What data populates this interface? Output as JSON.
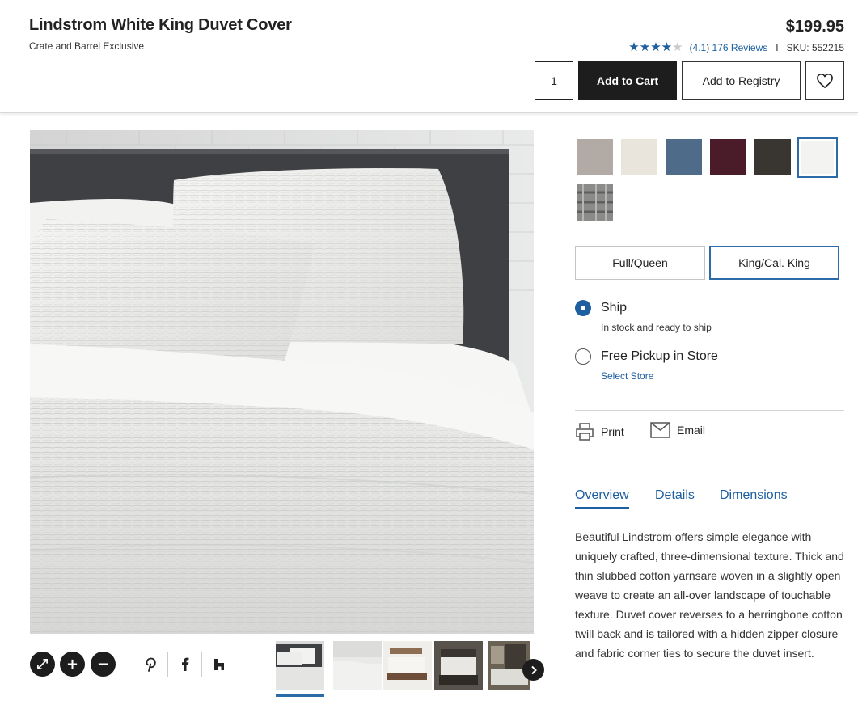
{
  "product": {
    "title": "Lindstrom White King Duvet Cover",
    "subtitle": "Crate and Barrel Exclusive",
    "price": "$199.95",
    "rating_value": 4.1,
    "stars_glyphs": "★★★★★",
    "reviews_text": "(4.1) 176 Reviews",
    "separator": "I",
    "sku": "SKU: 552215"
  },
  "purchase": {
    "quantity": "1",
    "add_to_cart": "Add to Cart",
    "add_to_registry": "Add to Registry"
  },
  "swatches": {
    "colors": [
      "#b2aba5",
      "#e9e5dd",
      "#4f6b8a",
      "#4a1c2a",
      "#393631",
      "#f3f3f1",
      "#8b8b89"
    ],
    "selected_index": 5
  },
  "sizes": {
    "options": [
      "Full/Queen",
      "King/Cal. King"
    ],
    "selected_index": 1
  },
  "delivery": {
    "ship_label": "Ship",
    "ship_sub": "In stock and ready to ship",
    "pickup_label": "Free Pickup in Store",
    "pickup_link": "Select Store",
    "selected": "ship"
  },
  "actions": {
    "print": "Print",
    "email": "Email"
  },
  "tabs": {
    "items": [
      "Overview",
      "Details",
      "Dimensions"
    ],
    "active_index": 0
  },
  "overview_text": "Beautiful Lindstrom offers simple elegance with uniquely crafted, three-dimensional texture. Thick and thin slubbed cotton yarnsare woven in a slightly open weave to create an all-over landscape of touchable texture. Duvet cover reverses to a herringbone cotton twill back and is tailored with a hidden zipper closure and fabric corner ties to secure the duvet insert.",
  "colors": {
    "accent": "#1d5fa0",
    "button_dark": "#1d1d1d",
    "selected_border": "#2d6aa8"
  },
  "icons": {
    "favorite": "heart-icon",
    "expand": "expand-icon",
    "zoom_in": "plus-icon",
    "zoom_out": "minus-icon",
    "share": [
      "pinterest-icon",
      "facebook-icon",
      "houzz-icon"
    ],
    "print": "printer-icon",
    "email": "envelope-icon",
    "next": "chevron-right-icon"
  }
}
